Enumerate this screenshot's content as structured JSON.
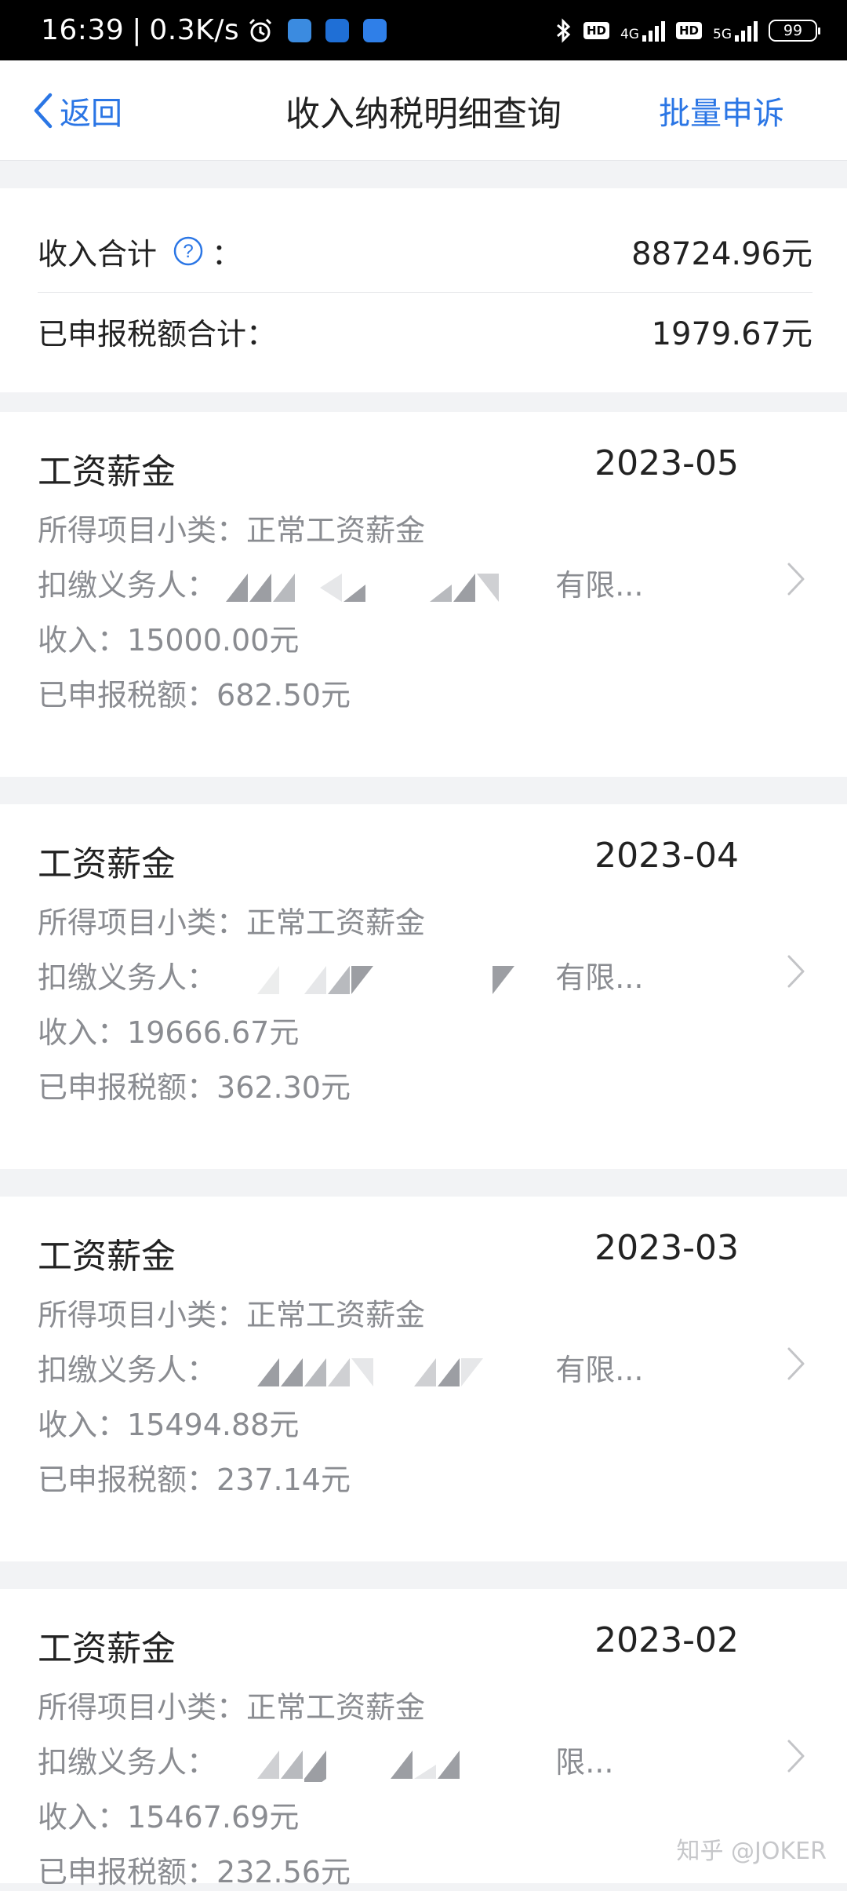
{
  "status_bar": {
    "time": "16:39",
    "separator": "|",
    "net_speed": "0.3K/s",
    "hd1": "HD",
    "net1": "4G",
    "hd2": "HD",
    "net2": "5G",
    "battery": "99"
  },
  "nav": {
    "back_label": "返回",
    "title": "收入纳税明细查询",
    "batch_appeal_label": "批量申诉"
  },
  "summary": {
    "income_label": "收入合计",
    "colon": "：",
    "income_value": "88724.96元",
    "tax_label": "已申报税额合计：",
    "tax_value": "1979.67元"
  },
  "records": [
    {
      "category": "工资薪金",
      "period": "2023-05",
      "subcategory_label": "所得项目小类：",
      "subcategory": "正常工资薪金",
      "payer_label": "扣缴义务人：",
      "payer_suffix": "有限...",
      "income_label": "收入：",
      "income": "15000.00元",
      "tax_label": "已申报税额：",
      "tax": "682.50元"
    },
    {
      "category": "工资薪金",
      "period": "2023-04",
      "subcategory_label": "所得项目小类：",
      "subcategory": "正常工资薪金",
      "payer_label": "扣缴义务人：",
      "payer_suffix": "有限...",
      "income_label": "收入：",
      "income": "19666.67元",
      "tax_label": "已申报税额：",
      "tax": "362.30元"
    },
    {
      "category": "工资薪金",
      "period": "2023-03",
      "subcategory_label": "所得项目小类：",
      "subcategory": "正常工资薪金",
      "payer_label": "扣缴义务人：",
      "payer_suffix": "有限...",
      "income_label": "收入：",
      "income": "15494.88元",
      "tax_label": "已申报税额：",
      "tax": "237.14元"
    },
    {
      "category": "工资薪金",
      "period": "2023-02",
      "subcategory_label": "所得项目小类：",
      "subcategory": "正常工资薪金",
      "payer_label": "扣缴义务人：",
      "payer_suffix": "限...",
      "income_label": "收入：",
      "income": "15467.69元",
      "tax_label": "已申报税额：",
      "tax": "232.56元"
    }
  ],
  "watermark": "知乎 @JOKER",
  "colors": {
    "accent": "#2b76e5",
    "secondary_text": "#8a8c91",
    "page_bg": "#f2f3f5"
  }
}
